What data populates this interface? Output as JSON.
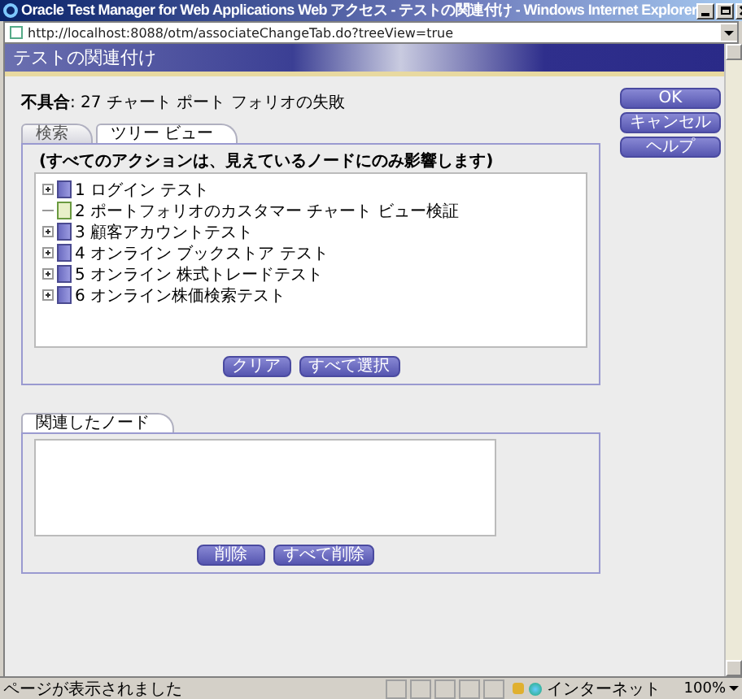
{
  "window": {
    "title": "Oracle Test Manager for Web Applications Web アクセス - テストの関連付け - Windows Internet Explorer"
  },
  "address": "http://localhost:8088/otm/associateChangeTab.do?treeView=true",
  "header": "テストの関連付け",
  "defect": "**不具合**: 27 チャート ポート フォリオの失敗",
  "tabs": [
    {
      "label": "検索",
      "selected": false
    },
    {
      "label": "ツリー ビュー",
      "selected": true
    }
  ],
  "tree_note": "(すべてのアクションは、見えているノードにのみ影響します)",
  "tree": [
    {
      "label": "1 ログイン テスト",
      "kind": "folder"
    },
    {
      "label": "2 ポートフォリオのカスタマー チャート ビュー検証",
      "kind": "test"
    },
    {
      "label": "3 顧客アカウントテスト",
      "kind": "folder"
    },
    {
      "label": "4 オンライン ブックストア テスト",
      "kind": "folder"
    },
    {
      "label": "5 オンライン 株式トレードテスト",
      "kind": "folder"
    },
    {
      "label": "6 オンライン株価検索テスト",
      "kind": "folder"
    }
  ],
  "tree_buttons": [
    "クリア",
    "すべて選択"
  ],
  "related_tab": "関連したノード",
  "related_buttons": [
    "削除",
    "すべて削除"
  ],
  "side_buttons": [
    "OK",
    "キャンセル",
    "ヘルプ"
  ],
  "status_bar": {
    "text": "ページが表示されました",
    "zone": "インターネット",
    "zoom": "100%"
  }
}
